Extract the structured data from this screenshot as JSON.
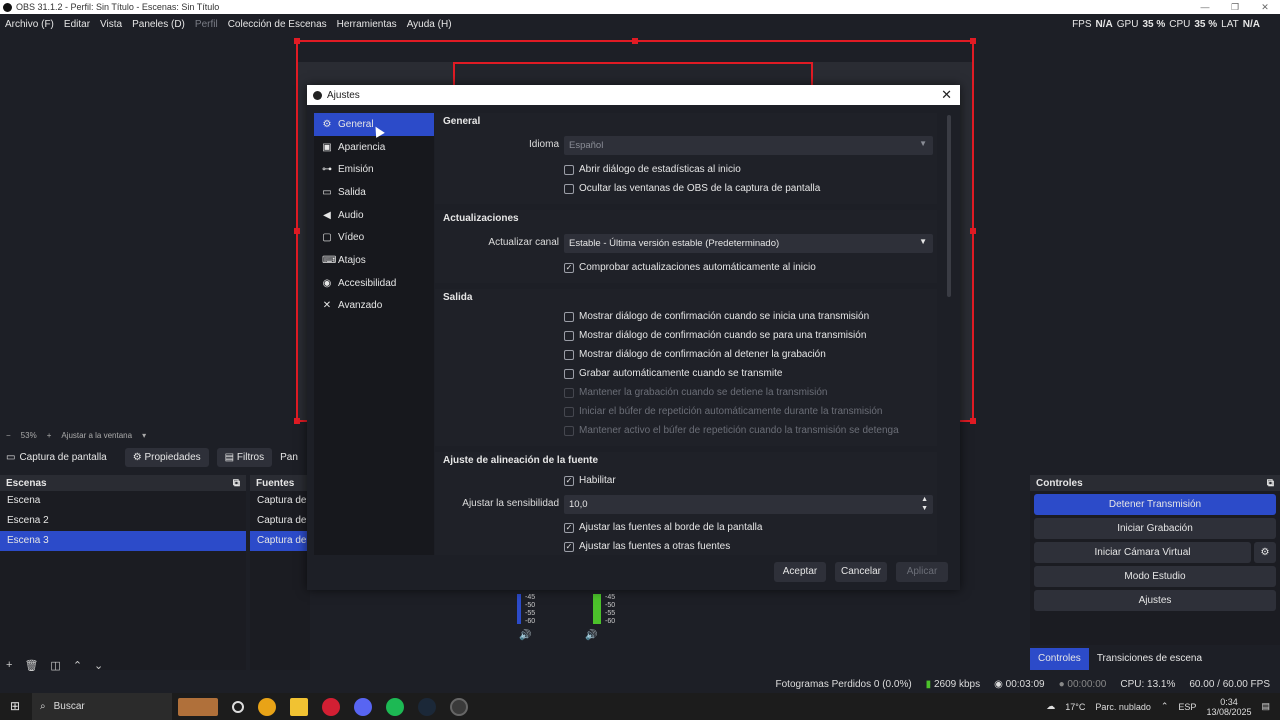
{
  "window": {
    "title": "OBS 31.1.2 - Perfil: Sin Título - Escenas: Sin Título"
  },
  "menu": [
    "Archivo (F)",
    "Editar",
    "Vista",
    "Paneles (D)",
    "Perfil",
    "Colección de Escenas",
    "Herramientas",
    "Ayuda (H)"
  ],
  "stats": {
    "fps_label": "FPS",
    "fps": "N/A",
    "gpu_label": "GPU",
    "gpu": "35 %",
    "cpu_label": "CPU",
    "cpu": "35 %",
    "lat_label": "LAT",
    "lat": "N/A"
  },
  "zoom": {
    "level": "53%",
    "fit": "Ajustar a la ventana"
  },
  "source_bar": {
    "name": "Captura de pantalla",
    "props": "Propiedades",
    "filters": "Filtros",
    "more": "Pan"
  },
  "scenes": {
    "title": "Escenas",
    "items": [
      "Escena",
      "Escena 2",
      "Escena 3"
    ],
    "selected": 2
  },
  "sources": {
    "title": "Fuentes",
    "items": [
      "Captura de pantalla",
      "Captura de pantalla",
      "Captura de pantalla"
    ]
  },
  "mixer": {
    "ticks": [
      "-45",
      "-50",
      "-55",
      "-60"
    ]
  },
  "controls": {
    "title": "Controles",
    "buttons": [
      "Detener Transmisión",
      "Iniciar Grabación",
      "Iniciar Cámara Virtual",
      "Modo Estudio",
      "Ajustes"
    ]
  },
  "control_tabs": [
    "Controles",
    "Transiciones de escena"
  ],
  "statusbar": {
    "frames": "Fotogramas Perdidos 0 (0.0%)",
    "kbps": "2609 kbps",
    "stream_time": "00:03:09",
    "rec_time": "00:00:00",
    "cpu": "CPU: 13.1%",
    "fps": "60.00 / 60.00 FPS"
  },
  "taskbar": {
    "search": "Buscar",
    "weather": "17°C",
    "weather_desc": "Parc. nublado",
    "lang": "ESP",
    "time": "0:34",
    "date": "13/08/2025"
  },
  "dialog": {
    "title": "Ajustes",
    "nav": [
      "General",
      "Apariencia",
      "Emisión",
      "Salida",
      "Audio",
      "Vídeo",
      "Atajos",
      "Accesibilidad",
      "Avanzado"
    ],
    "nav_selected": 0,
    "general": {
      "title": "General",
      "lang_label": "Idioma",
      "lang_value": "Español",
      "chk_stats": "Abrir diálogo de estadísticas al inicio",
      "chk_hide": "Ocultar las ventanas de OBS de la captura de pantalla"
    },
    "updates": {
      "title": "Actualizaciones",
      "channel_label": "Actualizar canal",
      "channel_value": "Estable - Última versión estable (Predeterminado)",
      "chk_auto": "Comprobar actualizaciones automáticamente al inicio"
    },
    "output": {
      "title": "Salida",
      "items": [
        "Mostrar diálogo de confirmación cuando se inicia una transmisión",
        "Mostrar diálogo de confirmación cuando se para una transmisión",
        "Mostrar diálogo de confirmación al detener la grabación",
        "Grabar automáticamente cuando se transmite",
        "Mantener la grabación cuando se detiene la transmisión",
        "Iniciar el búfer de repetición automáticamente durante la transmisión",
        "Mantener activo el búfer de repetición cuando la transmisión se detenga"
      ]
    },
    "snap": {
      "title": "Ajuste de alineación de la fuente",
      "enable": "Habilitar",
      "sens_label": "Ajustar la sensibilidad",
      "sens_value": "10,0",
      "chk_border": "Ajustar las fuentes al borde de la pantalla",
      "chk_other": "Ajustar las fuentes a otras fuentes"
    },
    "buttons": {
      "ok": "Aceptar",
      "cancel": "Cancelar",
      "apply": "Aplicar"
    }
  }
}
